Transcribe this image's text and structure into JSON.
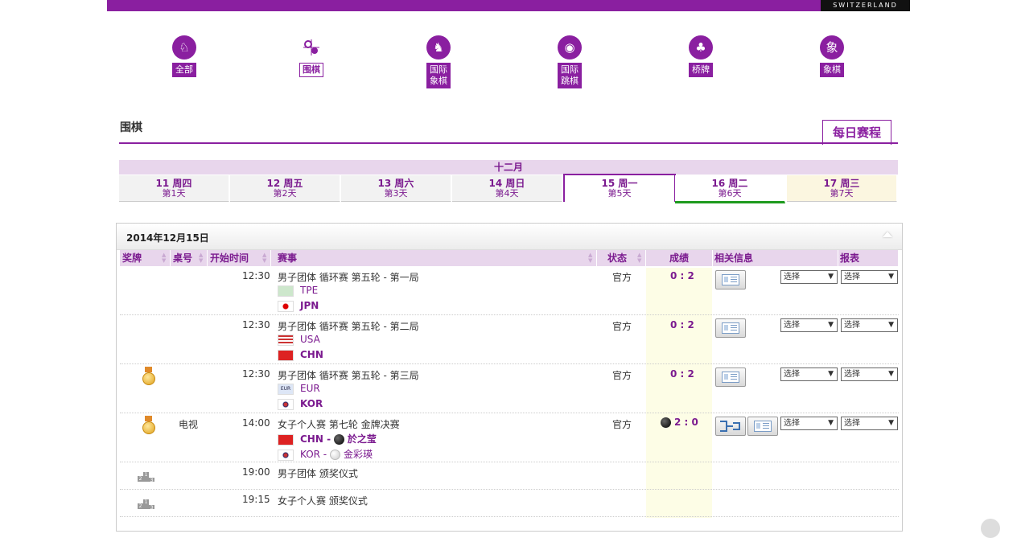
{
  "brand": "SWITZERLAND",
  "sports": [
    {
      "label": "全部",
      "icon": "all-sports-icon",
      "glyph": "♞"
    },
    {
      "label": "围棋",
      "icon": "go-icon",
      "glyph": "⚬"
    },
    {
      "label": "国际\n象棋",
      "icon": "chess-icon",
      "glyph": "♞"
    },
    {
      "label": "国际\n跳棋",
      "icon": "draughts-icon",
      "glyph": "◉"
    },
    {
      "label": "桥牌",
      "icon": "bridge-club-icon",
      "glyph": "♣"
    },
    {
      "label": "象棋",
      "icon": "xiangqi-icon",
      "glyph": "象"
    }
  ],
  "page_title": "围棋",
  "daily_tab": "每日赛程",
  "month": "十二月",
  "days": [
    {
      "d1": "11 周四",
      "d2": "第1天"
    },
    {
      "d1": "12 周五",
      "d2": "第2天"
    },
    {
      "d1": "13 周六",
      "d2": "第3天"
    },
    {
      "d1": "14 周日",
      "d2": "第4天"
    },
    {
      "d1": "15 周一",
      "d2": "第5天"
    },
    {
      "d1": "16 周二",
      "d2": "第6天"
    },
    {
      "d1": "17 周三",
      "d2": "第7天"
    }
  ],
  "panel_date": "2014年12月15日",
  "headers": {
    "medal": "奖牌",
    "table": "桌号",
    "start": "开始时间",
    "event": "赛事",
    "status": "状态",
    "result": "成绩",
    "info": "相关信息",
    "report": "报表"
  },
  "select_label": "选择",
  "rows": [
    {
      "time": "12:30",
      "event": "男子团体 循环赛 第五轮 - 第一局",
      "status": "官方",
      "score": "0 : 2",
      "team1": "TPE",
      "team2": "JPN"
    },
    {
      "time": "12:30",
      "event": "男子团体 循环赛 第五轮 - 第二局",
      "status": "官方",
      "score": "0 : 2",
      "team1": "USA",
      "team2": "CHN"
    },
    {
      "time": "12:30",
      "event": "男子团体 循环赛 第五轮 - 第三局",
      "status": "官方",
      "score": "0 : 2",
      "team1": "EUR",
      "team2": "KOR"
    },
    {
      "time": "14:00",
      "table": "电视",
      "event": "女子个人赛 第七轮 金牌决赛",
      "status": "官方",
      "score": "2 : 0",
      "team1": "CHN -",
      "player1": "於之莹",
      "team2": "KOR -",
      "player2": "金彩瑛"
    },
    {
      "time": "19:00",
      "event": "男子团体 颁奖仪式"
    },
    {
      "time": "19:15",
      "event": "女子个人赛 颁奖仪式"
    }
  ]
}
